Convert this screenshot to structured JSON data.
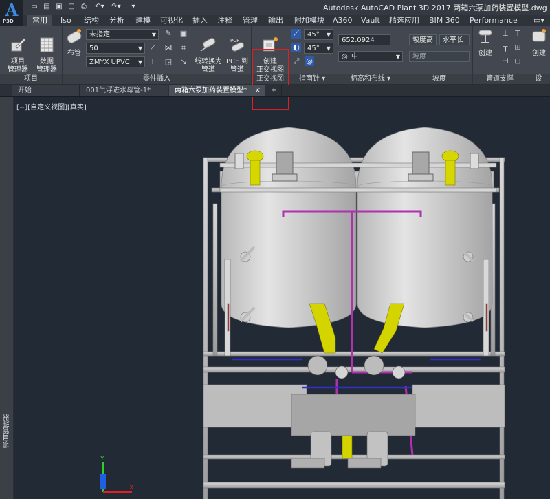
{
  "app": {
    "logo": "A",
    "logo_sub": "P3D",
    "title": "Autodesk AutoCAD Plant 3D 2017    两箱六泵加药装置模型.dwg"
  },
  "ribbon_tabs": [
    {
      "label": "常用"
    },
    {
      "label": "Iso"
    },
    {
      "label": "结构"
    },
    {
      "label": "分析"
    },
    {
      "label": "建模"
    },
    {
      "label": "可视化"
    },
    {
      "label": "插入"
    },
    {
      "label": "注释"
    },
    {
      "label": "管理"
    },
    {
      "label": "输出"
    },
    {
      "label": "附加模块"
    },
    {
      "label": "A360"
    },
    {
      "label": "Vault"
    },
    {
      "label": "精选应用"
    },
    {
      "label": "BIM 360"
    },
    {
      "label": "Performance"
    }
  ],
  "panels": {
    "project": {
      "label": "项目",
      "project_manager": "项目\n管理器",
      "data_manager": "数据\n管理器"
    },
    "part_insertion": {
      "label": "零件插入",
      "route_pipe": "布管",
      "spec_select": "未指定",
      "size_select": "50",
      "spec_name": "ZMYX UPVC",
      "line_to_pipe": "线转换为\n管道",
      "pcf_to_pipe": "PCF 到\n管道",
      "pcf_tag": "PCF"
    },
    "ortho": {
      "create_ortho": "创建\n正交视图",
      "label": "正交视图"
    },
    "compass": {
      "label": "指南针",
      "angle1": "45°",
      "angle2": "45°"
    },
    "elevation": {
      "label": "标高和布线",
      "elevation_value": "652.0924",
      "routing_option": "中"
    },
    "slope": {
      "label": "坡度",
      "slope_high": "坡度高",
      "slope_direction": "水平长度",
      "slope_field": "坡度"
    },
    "pipe_support": {
      "label": "管道支撑",
      "create": "创建"
    },
    "last": {
      "label": "设",
      "create": "创建"
    }
  },
  "doc_tabs": [
    {
      "label": "开始"
    },
    {
      "label": "001气浮进水母管-1*"
    },
    {
      "label": "两箱六泵加药装置模型*"
    }
  ],
  "doc_tab_add": "+",
  "viewport": {
    "label": "[−][自定义视图][真实]"
  },
  "side_palette": {
    "label": "项目管理器"
  },
  "ucs": {
    "y_label": "Y",
    "x_label": "X"
  },
  "colors": {
    "active_tab": "#454b53",
    "highlight": "#e02020",
    "pipe_yellow": "#d4d400",
    "pipe_magenta": "#b030b0",
    "pipe_blue": "#3030c8",
    "tank": "#cfcfcf"
  }
}
